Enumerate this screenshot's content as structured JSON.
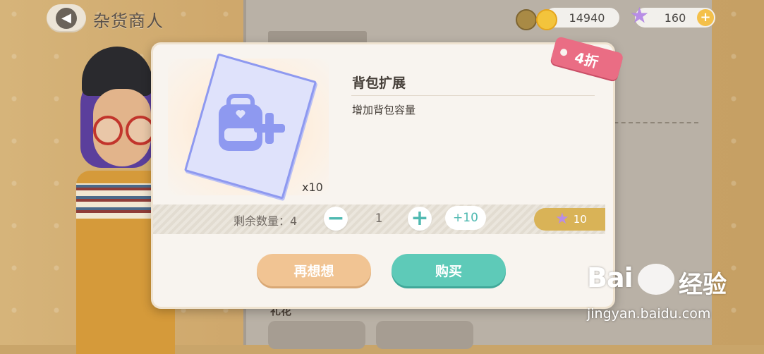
{
  "header": {
    "title": "杂货商人",
    "coins": "14940",
    "stars": "160",
    "add_symbol": "+"
  },
  "background": {
    "section_label": "礼花"
  },
  "dialog": {
    "item_name": "背包扩展",
    "item_description": "增加背包容量",
    "item_quantity": "x10",
    "discount": "4折",
    "remaining_label": "剩余数量：4",
    "selected_quantity": "1",
    "minus_symbol": "−",
    "plus_symbol": "+",
    "plus10_label": "+10",
    "price": "10",
    "cancel_label": "再想想",
    "buy_label": "购买"
  },
  "watermark": {
    "logo_text": "Bai",
    "logo_suffix": "经验",
    "url": "jingyan.baidu.com"
  },
  "colors": {
    "accent_teal": "#5ecab8",
    "cancel_orange": "#f1c493",
    "discount_pink": "#ea6d84",
    "price_gold": "#d9b357",
    "star_purple": "#b88de6"
  },
  "icons": [
    "back-arrow-icon",
    "bronze-coin-icon",
    "gold-coin-icon",
    "star-icon",
    "plus-icon",
    "backpack-plus-icon",
    "price-star-icon"
  ]
}
